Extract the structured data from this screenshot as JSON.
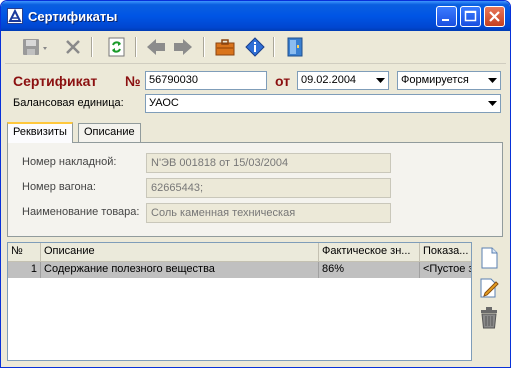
{
  "window": {
    "title": "Сертификаты"
  },
  "toolbar": {
    "icons": [
      "save-icon",
      "delete-icon",
      "refresh-icon",
      "back-arrow-icon",
      "forward-arrow-icon",
      "briefcase-icon",
      "info-icon",
      "exit-door-icon"
    ]
  },
  "header": {
    "cert_label": "Сертификат",
    "num_label": "№",
    "number": "56790030",
    "date_label": "от",
    "date": "09.02.2004",
    "status": "Формируется",
    "unit_label": "Балансовая единица:",
    "unit": "УАОС"
  },
  "tabs": [
    {
      "label": "Реквизиты",
      "active": true
    },
    {
      "label": "Описание",
      "active": false
    }
  ],
  "details": {
    "invoice_label": "Номер накладной:",
    "invoice": "N'ЭВ 001818 от 15/03/2004",
    "wagon_label": "Номер вагона:",
    "wagon": "62665443;",
    "goods_label": "Наименование товара:",
    "goods": "Соль каменная техническая"
  },
  "grid": {
    "columns": [
      "№",
      "Описание",
      "Фактическое зн...",
      "Показа..."
    ],
    "rows": [
      {
        "num": "1",
        "desc": "Содержание полезного вещества",
        "actual": "86%",
        "indicator": "<Пустое з"
      }
    ]
  },
  "side_icons": [
    "new-document-icon",
    "edit-icon",
    "trash-icon"
  ],
  "colors": {
    "title_bar": "#0055e5",
    "label_red": "#8b1010",
    "window_bg": "#ece9d8"
  }
}
